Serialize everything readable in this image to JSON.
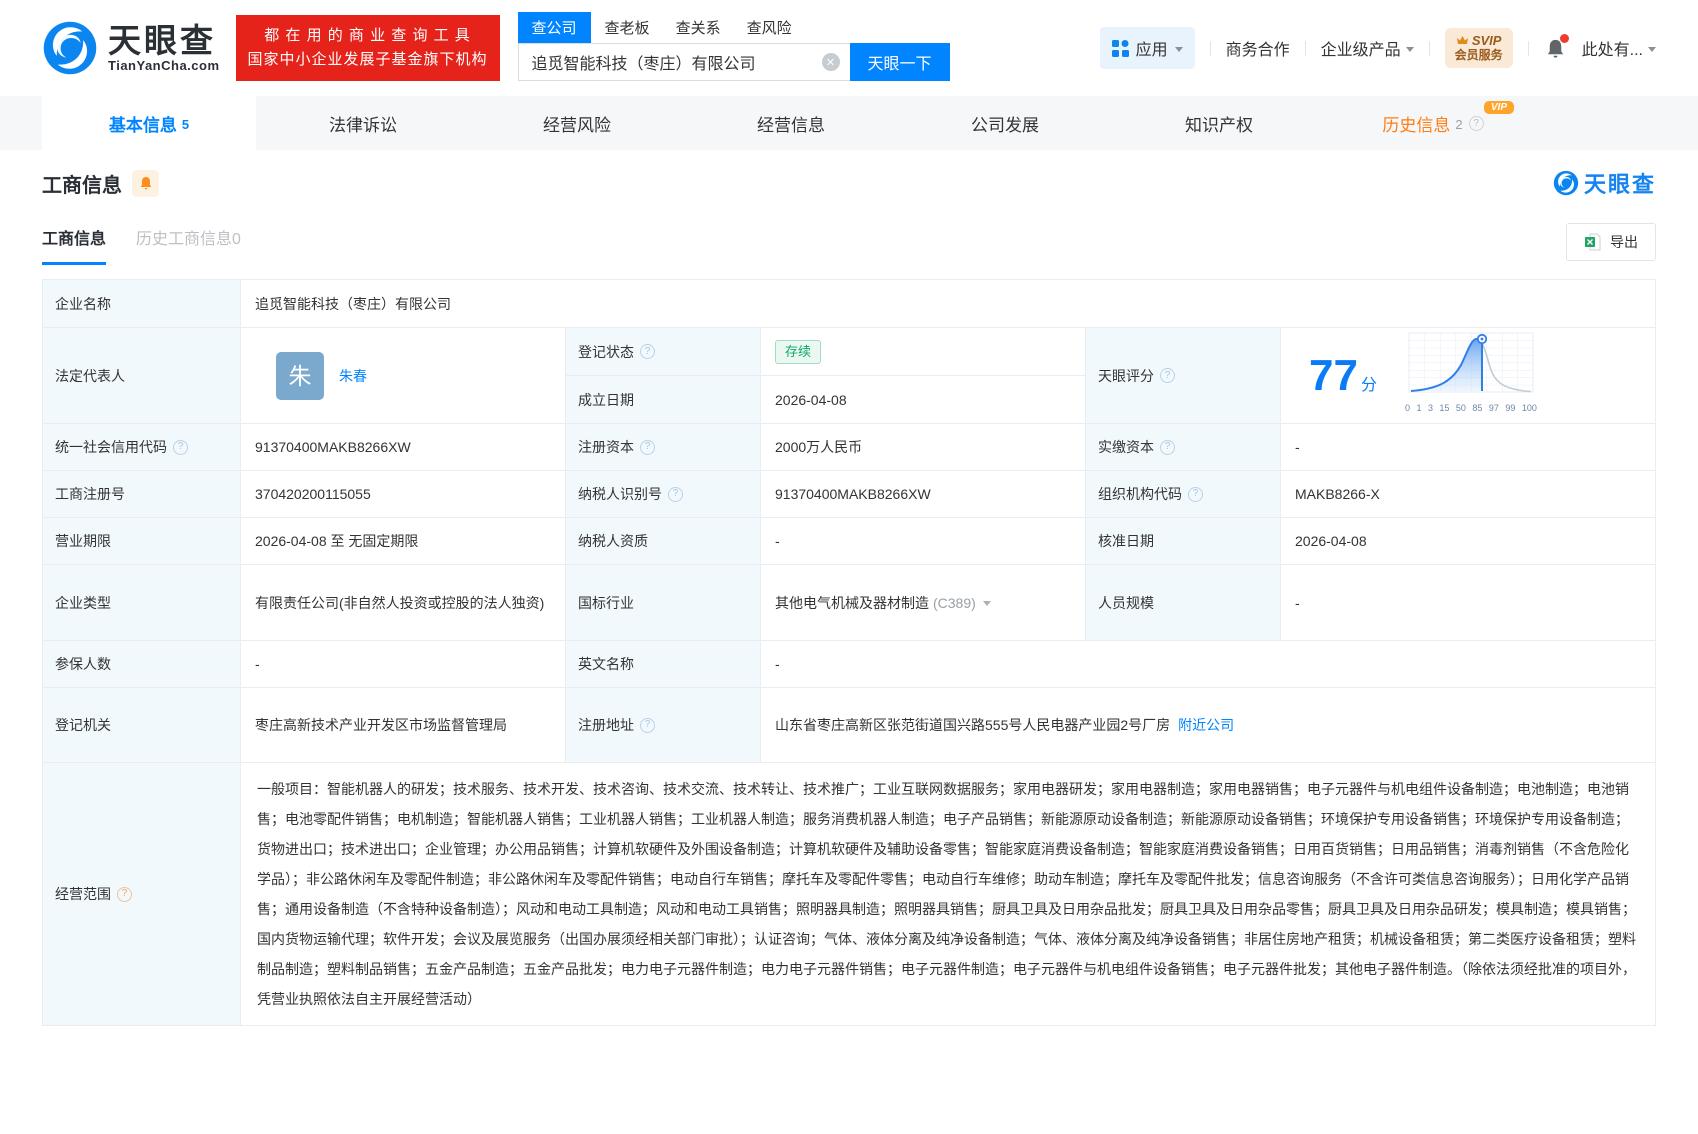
{
  "icons": {
    "help": "?",
    "clear": "✕"
  },
  "brand": {
    "logo_text": "天眼查",
    "logo_domain": "TianYanCha.com",
    "slogan_line1": "都 在 用 的 商 业 查 询 工 具",
    "slogan_line2": "国家中小企业发展子基金旗下机构"
  },
  "search": {
    "tabs": [
      {
        "id": "company",
        "label": "查公司",
        "active": true
      },
      {
        "id": "boss",
        "label": "查老板"
      },
      {
        "id": "relation",
        "label": "查关系"
      },
      {
        "id": "risk",
        "label": "查风险"
      }
    ],
    "value": "追觅智能科技（枣庄）有限公司",
    "button": "天眼一下"
  },
  "header_right": {
    "apps": "应用",
    "business": "商务合作",
    "enterprise": "企业级产品",
    "svip_line1": "SVIP",
    "svip_line2": "会员服务",
    "more": "此处有..."
  },
  "nav_tabs": [
    {
      "id": "basic",
      "label": "基本信息",
      "count": "5",
      "active": true
    },
    {
      "id": "lawsuit",
      "label": "法律诉讼"
    },
    {
      "id": "risk",
      "label": "经营风险"
    },
    {
      "id": "operation",
      "label": "经营信息"
    },
    {
      "id": "development",
      "label": "公司发展"
    },
    {
      "id": "ip",
      "label": "知识产权"
    },
    {
      "id": "history",
      "label": "历史信息",
      "count": "2",
      "orange": true,
      "badge": "VIP",
      "help": true
    }
  ],
  "section": {
    "title": "工商信息",
    "watermark": "天眼查",
    "subtabs": [
      {
        "id": "current",
        "label": "工商信息",
        "active": true
      },
      {
        "id": "history",
        "label": "历史工商信息0"
      }
    ],
    "export_label": "导出"
  },
  "fields": {
    "company_name": {
      "label": "企业名称",
      "value": "追觅智能科技（枣庄）有限公司"
    },
    "legal_rep": {
      "label": "法定代表人",
      "avatar": "朱",
      "name": "朱春"
    },
    "reg_status": {
      "label": "登记状态",
      "value": "存续"
    },
    "establish_date": {
      "label": "成立日期",
      "value": "2026-04-08"
    },
    "score": {
      "label": "天眼评分",
      "value": "77",
      "unit": "分",
      "axis": [
        "0",
        "1",
        "3",
        "15",
        "50",
        "85",
        "97",
        "99",
        "100"
      ]
    },
    "credit_code": {
      "label": "统一社会信用代码",
      "value": "91370400MAKB8266XW"
    },
    "reg_capital": {
      "label": "注册资本",
      "value": "2000万人民币"
    },
    "paid_capital": {
      "label": "实缴资本",
      "value": "-"
    },
    "reg_number": {
      "label": "工商注册号",
      "value": "370420200115055"
    },
    "taxpayer_id": {
      "label": "纳税人识别号",
      "value": "91370400MAKB8266XW"
    },
    "org_code": {
      "label": "组织机构代码",
      "value": "MAKB8266-X"
    },
    "business_term": {
      "label": "营业期限",
      "value": "2026-04-08 至 无固定期限"
    },
    "taxpayer_quality": {
      "label": "纳税人资质",
      "value": "-"
    },
    "approval_date": {
      "label": "核准日期",
      "value": "2026-04-08"
    },
    "company_type": {
      "label": "企业类型",
      "value": "有限责任公司(非自然人投资或控股的法人独资)"
    },
    "industry": {
      "label": "国标行业",
      "value": "其他电气机械及器材制造",
      "code": "(C389)"
    },
    "staff_size": {
      "label": "人员规模",
      "value": "-"
    },
    "insured_count": {
      "label": "参保人数",
      "value": "-"
    },
    "english_name": {
      "label": "英文名称",
      "value": "-"
    },
    "reg_authority": {
      "label": "登记机关",
      "value": "枣庄高新技术产业开发区市场监督管理局"
    },
    "reg_address": {
      "label": "注册地址",
      "value": "山东省枣庄高新区张范街道国兴路555号人民电器产业园2号厂房",
      "link": "附近公司"
    },
    "business_scope": {
      "label": "经营范围",
      "value": "一般项目：智能机器人的研发；技术服务、技术开发、技术咨询、技术交流、技术转让、技术推广；工业互联网数据服务；家用电器研发；家用电器制造；家用电器销售；电子元器件与机电组件设备制造；电池制造；电池销售；电池零配件销售；电机制造；智能机器人销售；工业机器人销售；工业机器人制造；服务消费机器人制造；电子产品销售；新能源原动设备制造；新能源原动设备销售；环境保护专用设备销售；环境保护专用设备制造；货物进出口；技术进出口；企业管理；办公用品销售；计算机软硬件及外围设备制造；计算机软硬件及辅助设备零售；智能家庭消费设备制造；智能家庭消费设备销售；日用百货销售；日用品销售；消毒剂销售（不含危险化学品）；非公路休闲车及零配件制造；非公路休闲车及零配件销售；电动自行车销售；摩托车及零配件零售；电动自行车维修；助动车制造；摩托车及零配件批发；信息咨询服务（不含许可类信息咨询服务）；日用化学产品销售；通用设备制造（不含特种设备制造）；风动和电动工具制造；风动和电动工具销售；照明器具制造；照明器具销售；厨具卫具及日用杂品批发；厨具卫具及日用杂品零售；厨具卫具及日用杂品研发；模具制造；模具销售；国内货物运输代理；软件开发；会议及展览服务（出国办展须经相关部门审批）；认证咨询；气体、液体分离及纯净设备制造；气体、液体分离及纯净设备销售；非居住房地产租赁；机械设备租赁；第二类医疗设备租赁；塑料制品制造；塑料制品销售；五金产品制造；五金产品批发；电力电子元器件制造；电力电子元器件销售；电子元器件制造；电子元器件与机电组件设备销售；电子元器件批发；其他电子器件制造。（除依法须经批准的项目外，凭营业执照依法自主开展经营活动）"
    }
  }
}
